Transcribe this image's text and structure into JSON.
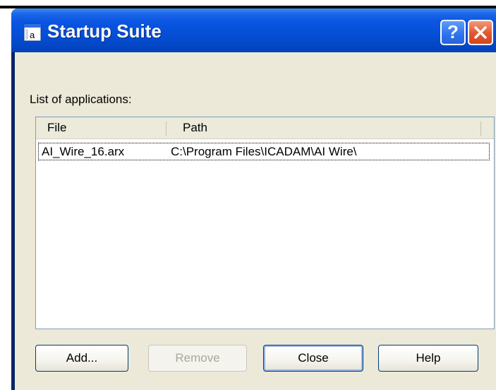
{
  "window": {
    "title": "Startup Suite",
    "help_label": "?",
    "icon": "app-icon"
  },
  "list": {
    "label": "List of applications:",
    "columns": [
      "File",
      "Path"
    ],
    "rows": [
      {
        "file": "AI_Wire_16.arx",
        "path": "C:\\Program Files\\ICADAM\\AI Wire\\"
      }
    ]
  },
  "buttons": {
    "add": "Add...",
    "remove": "Remove",
    "close": "Close",
    "help": "Help"
  },
  "colors": {
    "titlebar": "#0650d8",
    "client": "#ece9d8",
    "close_button": "#e2552d"
  }
}
